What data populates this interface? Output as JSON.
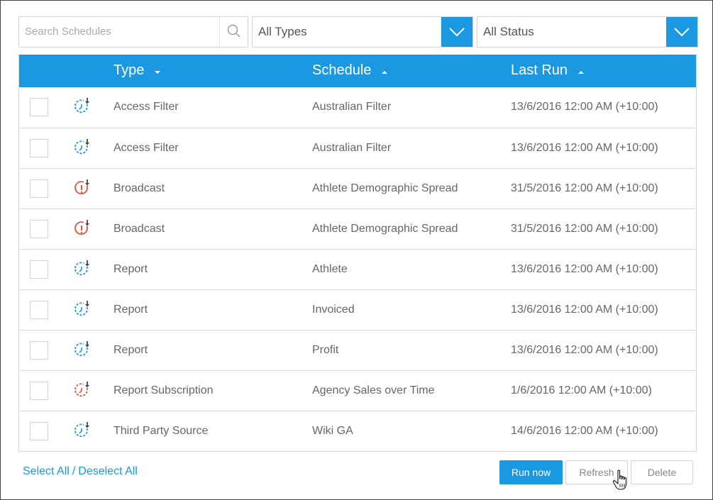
{
  "filters": {
    "search_placeholder": "Search Schedules",
    "type_select": "All Types",
    "status_select": "All Status"
  },
  "table": {
    "headers": {
      "type": "Type",
      "schedule": "Schedule",
      "last_run": "Last Run"
    },
    "sort": {
      "type": "desc",
      "schedule": "asc",
      "last_run": "asc"
    },
    "rows": [
      {
        "icon": "clock-refresh-icon",
        "icon_color": "#1a98e1",
        "type": "Access Filter",
        "schedule": "Australian Filter",
        "last_run": "13/6/2016 12:00 AM (+10:00)"
      },
      {
        "icon": "clock-refresh-icon",
        "icon_color": "#1a98e1",
        "type": "Access Filter",
        "schedule": "Australian Filter",
        "last_run": "13/6/2016 12:00 AM (+10:00)"
      },
      {
        "icon": "alert-clock-icon",
        "icon_color": "#e5533d",
        "type": "Broadcast",
        "schedule": "Athlete Demographic Spread",
        "last_run": "31/5/2016 12:00 AM (+10:00)"
      },
      {
        "icon": "alert-clock-icon",
        "icon_color": "#e5533d",
        "type": "Broadcast",
        "schedule": "Athlete Demographic Spread",
        "last_run": "31/5/2016 12:00 AM (+10:00)"
      },
      {
        "icon": "clock-refresh-icon",
        "icon_color": "#1a98e1",
        "type": "Report",
        "schedule": "Athlete",
        "last_run": "13/6/2016 12:00 AM (+10:00)"
      },
      {
        "icon": "clock-refresh-icon",
        "icon_color": "#1a98e1",
        "type": "Report",
        "schedule": "Invoiced",
        "last_run": "13/6/2016 12:00 AM (+10:00)"
      },
      {
        "icon": "clock-refresh-icon",
        "icon_color": "#1a98e1",
        "type": "Report",
        "schedule": "Profit",
        "last_run": "13/6/2016 12:00 AM (+10:00)"
      },
      {
        "icon": "clock-refresh-icon",
        "icon_color": "#e5533d",
        "type": "Report Subscription",
        "schedule": "Agency Sales over Time",
        "last_run": "1/6/2016 12:00 AM (+10:00)"
      },
      {
        "icon": "clock-refresh-icon",
        "icon_color": "#1a98e1",
        "type": "Third Party Source",
        "schedule": "Wiki GA",
        "last_run": "14/6/2016 12:00 AM (+10:00)"
      }
    ]
  },
  "footer": {
    "select_all": "Select All",
    "separator": "/",
    "deselect_all": "Deselect All",
    "run_now": "Run now",
    "refresh": "Refresh",
    "delete": "Delete"
  },
  "colors": {
    "accent": "#1a98e1",
    "alert": "#e5533d"
  }
}
